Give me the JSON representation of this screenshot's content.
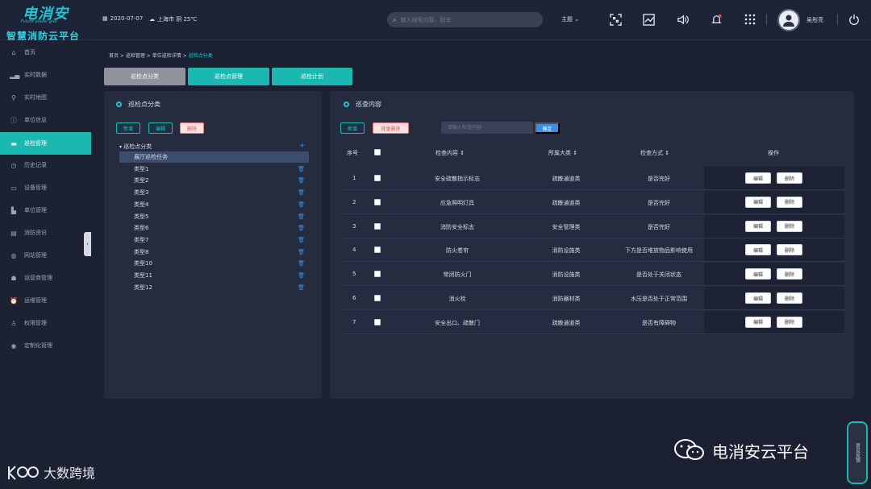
{
  "brand": {
    "logo_text": "电消安",
    "logo_sub": "Future power grid",
    "platform": "智慧消防云平台"
  },
  "header": {
    "date": "2020-07-07",
    "weather": "上海市 阴 25℃",
    "search_placeholder": "输入搜索内容，回车",
    "theme": "主题",
    "username": "吴彤亮"
  },
  "sidebar": {
    "items": [
      {
        "label": "首页",
        "icon": "home-icon"
      },
      {
        "label": "实时数据",
        "icon": "chart-icon"
      },
      {
        "label": "实时地图",
        "icon": "map-pin-icon"
      },
      {
        "label": "单位信息",
        "icon": "info-icon"
      },
      {
        "label": "巡检管理",
        "icon": "folder-icon"
      },
      {
        "label": "历史记录",
        "icon": "clock-icon"
      },
      {
        "label": "设备管理",
        "icon": "monitor-icon"
      },
      {
        "label": "单位管理",
        "icon": "building-icon"
      },
      {
        "label": "消防资讯",
        "icon": "message-icon"
      },
      {
        "label": "网站管理",
        "icon": "globe-icon"
      },
      {
        "label": "运营商管理",
        "icon": "users-icon"
      },
      {
        "label": "运维管理",
        "icon": "alarm-icon"
      },
      {
        "label": "权限管理",
        "icon": "person-icon"
      },
      {
        "label": "定制化管理",
        "icon": "settings-icon"
      }
    ],
    "active_index": 4
  },
  "breadcrumb": {
    "items": [
      "首页",
      "巡检管理",
      "单位巡检详情"
    ],
    "current": "巡检点分类"
  },
  "tabs": [
    "巡检点分类",
    "巡检点管理",
    "巡检计划"
  ],
  "left_panel": {
    "title": "巡检点分类",
    "buttons": {
      "add": "新增",
      "edit": "编辑",
      "delete": "删除"
    },
    "tree_root": "巡检点分类",
    "tree_items": [
      "展厅巡检任务",
      "类型1",
      "类型2",
      "类型3",
      "类型4",
      "类型5",
      "类型6",
      "类型7",
      "类型8",
      "类型10",
      "类型11",
      "类型12"
    ]
  },
  "right_panel": {
    "title": "巡查内容",
    "buttons": {
      "add": "新增",
      "batch_delete": "批量删除",
      "confirm": "确定"
    },
    "search_placeholder": "请输入检查内容",
    "columns": [
      "序号",
      "检查内容",
      "所属大类",
      "检查方式",
      "操作"
    ],
    "row_edit": "编辑",
    "row_delete": "删除",
    "rows": [
      {
        "no": "1",
        "content": "安全疏散指示标志",
        "category": "疏散通道类",
        "method": "是否完好"
      },
      {
        "no": "2",
        "content": "应急照明灯具",
        "category": "疏散通道类",
        "method": "是否完好"
      },
      {
        "no": "3",
        "content": "消防安全标志",
        "category": "安全管理类",
        "method": "是否完好"
      },
      {
        "no": "4",
        "content": "防火卷帘",
        "category": "消防设施类",
        "method": "下方是否堆放物品影响使用"
      },
      {
        "no": "5",
        "content": "常闭防火门",
        "category": "消防设施类",
        "method": "是否处于关闭状态"
      },
      {
        "no": "6",
        "content": "消火栓",
        "category": "消防器材类",
        "method": "水压是否处于正常范围"
      },
      {
        "no": "7",
        "content": "安全出口、疏散门",
        "category": "疏散通道类",
        "method": "是否有障碍物"
      }
    ]
  },
  "float_tab": "意见反馈",
  "watermarks": {
    "wechat": "电消安云平台",
    "brand2": "大数跨境"
  },
  "colors": {
    "accent": "#1bb7b1",
    "bg": "#1b2133",
    "panel": "#252c3f",
    "link": "#3a8ee6"
  }
}
